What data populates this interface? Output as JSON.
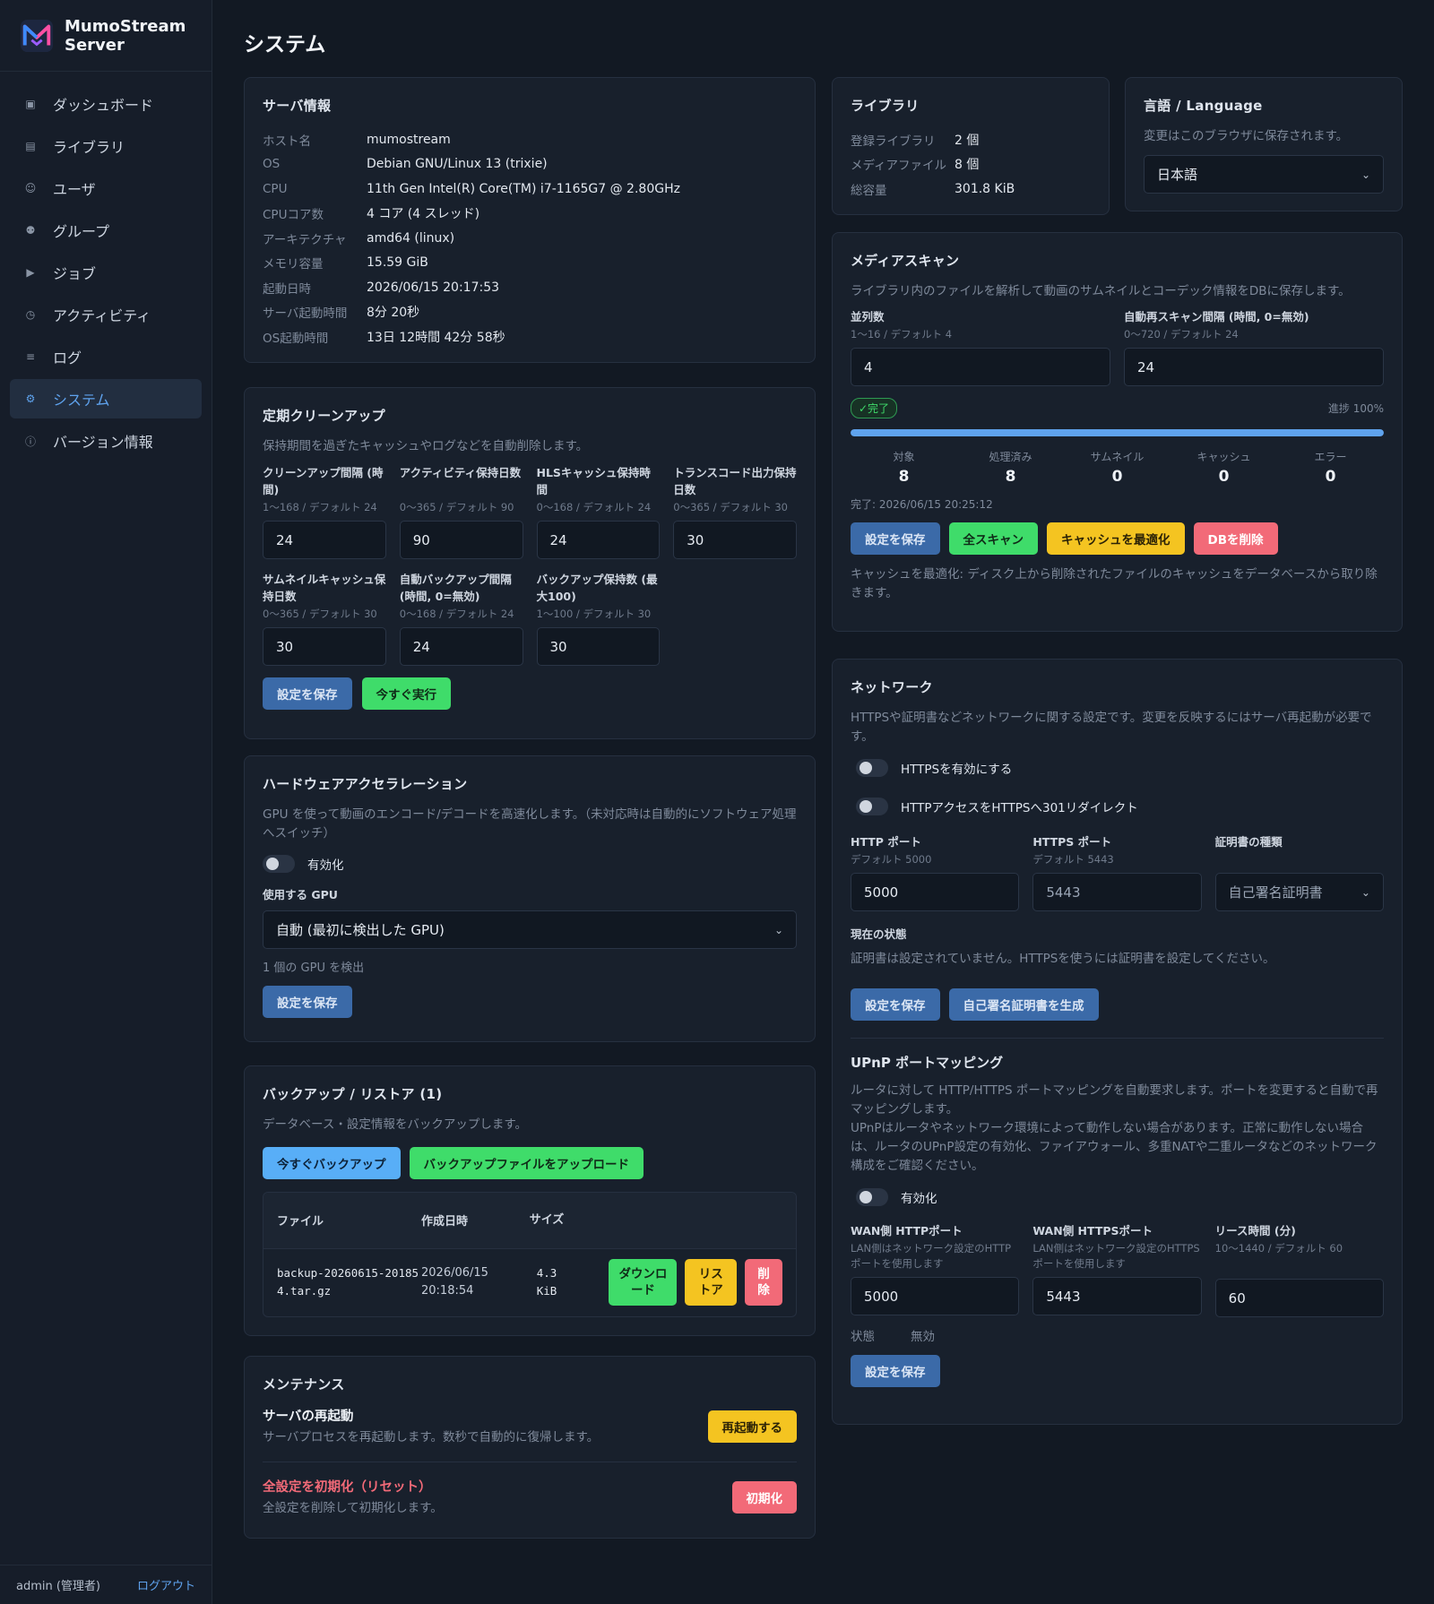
{
  "app": {
    "name": "MumoStream Server"
  },
  "nav": {
    "items": [
      {
        "label": "ダッシュボード",
        "icon": "▣"
      },
      {
        "label": "ライブラリ",
        "icon": "▤"
      },
      {
        "label": "ユーザ",
        "icon": "☺"
      },
      {
        "label": "グループ",
        "icon": "⚉"
      },
      {
        "label": "ジョブ",
        "icon": "▶"
      },
      {
        "label": "アクティビティ",
        "icon": "◷"
      },
      {
        "label": "ログ",
        "icon": "≡"
      },
      {
        "label": "システム",
        "icon": "⚙"
      },
      {
        "label": "バージョン情報",
        "icon": "ⓘ"
      }
    ],
    "active": "システム"
  },
  "footer": {
    "user": "admin (管理者)",
    "logout": "ログアウト"
  },
  "page": {
    "title": "システム"
  },
  "server_info": {
    "title": "サーバ情報",
    "rows": [
      {
        "k": "ホスト名",
        "v": "mumostream"
      },
      {
        "k": "OS",
        "v": "Debian GNU/Linux 13 (trixie)"
      },
      {
        "k": "CPU",
        "v": "11th Gen Intel(R) Core(TM) i7-1165G7 @ 2.80GHz"
      },
      {
        "k": "CPUコア数",
        "v": "4 コア (4 スレッド)"
      },
      {
        "k": "アーキテクチャ",
        "v": "amd64 (linux)"
      },
      {
        "k": "メモリ容量",
        "v": "15.59 GiB"
      },
      {
        "k": "起動日時",
        "v": "2026/06/15 20:17:53"
      },
      {
        "k": "サーバ起動時間",
        "v": "8分 20秒"
      },
      {
        "k": "OS起動時間",
        "v": "13日 12時間 42分 58秒"
      }
    ]
  },
  "cleanup": {
    "title": "定期クリーンアップ",
    "desc": "保持期間を過ぎたキャッシュやログなどを自動削除します。",
    "fields": [
      {
        "label": "クリーンアップ間隔 (時間)",
        "hint": "1〜168 / デフォルト 24",
        "value": "24"
      },
      {
        "label": "アクティビティ保持日数",
        "hint": "0〜365 / デフォルト 90",
        "value": "90"
      },
      {
        "label": "HLSキャッシュ保持時間",
        "hint": "0〜168 / デフォルト 24",
        "value": "24"
      },
      {
        "label": "トランスコード出力保持日数",
        "hint": "0〜365 / デフォルト 30",
        "value": "30"
      },
      {
        "label": "サムネイルキャッシュ保持日数",
        "hint": "0〜365 / デフォルト 30",
        "value": "30"
      },
      {
        "label": "自動バックアップ間隔 (時間, 0=無効)",
        "hint": "0〜168 / デフォルト 24",
        "value": "24"
      },
      {
        "label": "バックアップ保持数 (最大100)",
        "hint": "1〜100 / デフォルト 30",
        "value": "30"
      }
    ],
    "save": "設定を保存",
    "run_now": "今すぐ実行"
  },
  "hwaccel": {
    "title": "ハードウェアアクセラレーション",
    "desc": "GPU を使って動画のエンコード/デコードを高速化します。（未対応時は自動的にソフトウェア処理へスイッチ）",
    "enable": "有効化",
    "gpu_label": "使用する GPU",
    "gpu_value": "自動 (最初に検出した GPU)",
    "detected": "1 個の GPU を検出",
    "save": "設定を保存"
  },
  "backup": {
    "title": "バックアップ / リストア (1)",
    "desc": "データベース・設定情報をバックアップします。",
    "backup_now": "今すぐバックアップ",
    "upload": "バックアップファイルをアップロード",
    "columns": [
      "ファイル",
      "作成日時",
      "サイズ"
    ],
    "rows": [
      {
        "file": "backup-20260615-201854.tar.gz",
        "created": "2026/06/15 20:18:54",
        "size": "4.3 KiB"
      }
    ],
    "download": "ダウンロード",
    "restore": "リストア",
    "delete": "削除"
  },
  "maintenance": {
    "title": "メンテナンス",
    "restart_title": "サーバの再起動",
    "restart_desc": "サーバプロセスを再起動します。数秒で自動的に復帰します。",
    "restart_btn": "再起動する",
    "reset_title": "全設定を初期化（リセット）",
    "reset_desc": "全設定を削除して初期化します。",
    "reset_btn": "初期化"
  },
  "library": {
    "title": "ライブラリ",
    "rows": [
      {
        "k": "登録ライブラリ",
        "v": "2 個"
      },
      {
        "k": "メディアファイル",
        "v": "8 個"
      },
      {
        "k": "総容量",
        "v": "301.8 KiB"
      }
    ]
  },
  "language": {
    "title": "言語 / Language",
    "desc": "変更はこのブラウザに保存されます。",
    "value": "日本語"
  },
  "scan": {
    "title": "メディアスキャン",
    "desc": "ライブラリ内のファイルを解析して動画のサムネイルとコーデック情報をDBに保存します。",
    "parallel_label": "並列数",
    "parallel_hint": "1〜16 / デフォルト 4",
    "parallel_value": "4",
    "interval_label": "自動再スキャン間隔 (時間, 0=無効)",
    "interval_hint": "0〜720 / デフォルト 24",
    "interval_value": "24",
    "status": "✓完了",
    "progress_text": "進捗 100%",
    "progress": 1.0,
    "stats": [
      {
        "label": "対象",
        "value": "8"
      },
      {
        "label": "処理済み",
        "value": "8"
      },
      {
        "label": "サムネイル",
        "value": "0"
      },
      {
        "label": "キャッシュ",
        "value": "0"
      },
      {
        "label": "エラー",
        "value": "0"
      }
    ],
    "completed": "完了: 2026/06/15 20:25:12",
    "save": "設定を保存",
    "full_scan": "全スキャン",
    "optimize": "キャッシュを最適化",
    "delete_db": "DBを削除",
    "note": "キャッシュを最適化: ディスク上から削除されたファイルのキャッシュをデータベースから取り除きます。"
  },
  "network": {
    "title": "ネットワーク",
    "desc": "HTTPSや証明書などネットワークに関する設定です。変更を反映するにはサーバ再起動が必要です。",
    "https_enable": "HTTPSを有効にする",
    "redirect": "HTTPアクセスをHTTPSへ301リダイレクト",
    "http_port_label": "HTTP ポート",
    "http_port_hint": "デフォルト 5000",
    "http_port": "5000",
    "https_port_label": "HTTPS ポート",
    "https_port_hint": "デフォルト 5443",
    "https_port": "5443",
    "cert_label": "証明書の種類",
    "cert_value": "自己署名証明書",
    "state_label": "現在の状態",
    "state_text": "証明書は設定されていません。HTTPSを使うには証明書を設定してください。",
    "save": "設定を保存",
    "gen_cert": "自己署名証明書を生成",
    "upnp_title": "UPnP ポートマッピング",
    "upnp_desc1": "ルータに対して HTTP/HTTPS ポートマッピングを自動要求します。ポートを変更すると自動で再マッピングします。",
    "upnp_desc2": "UPnPはルータやネットワーク環境によって動作しない場合があります。正常に動作しない場合は、ルータのUPnP設定の有効化、ファイアウォール、多重NATや二重ルータなどのネットワーク構成をご確認ください。",
    "upnp_enable": "有効化",
    "wan_http_label": "WAN側 HTTPポート",
    "wan_http_hint": "LAN側はネットワーク設定のHTTPポートを使用します",
    "wan_http": "5000",
    "wan_https_label": "WAN側 HTTPSポート",
    "wan_https_hint": "LAN側はネットワーク設定のHTTPSポートを使用します",
    "wan_https": "5443",
    "lease_label": "リース時間 (分)",
    "lease_hint": "10〜1440 / デフォルト 60",
    "lease": "60",
    "upnp_state_label": "状態",
    "upnp_state": "無効",
    "upnp_save": "設定を保存"
  },
  "colors": {
    "accent": "#5fa3ee",
    "bg": "#121923",
    "card": "#18202c",
    "green": "#3fdc6a",
    "yellow": "#f4c421",
    "red": "#f26a78"
  }
}
